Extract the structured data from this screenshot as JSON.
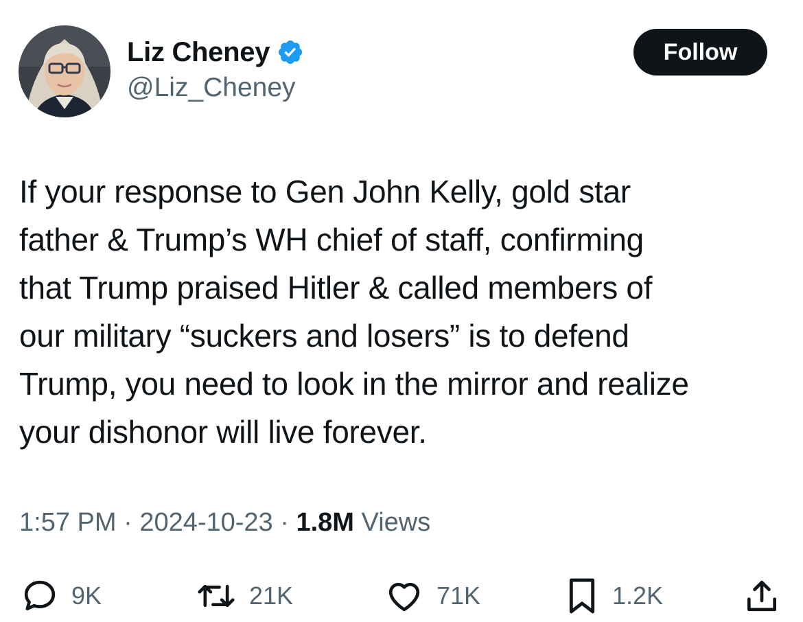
{
  "author": {
    "display_name": "Liz Cheney",
    "handle": "@Liz_Cheney",
    "verified": true,
    "avatar_icon": "profile-photo"
  },
  "follow_label": "Follow",
  "tweet": {
    "text_lines": [
      "If your response to Gen John Kelly, gold star",
      "father & Trump’s WH chief of staff, confirming",
      "that Trump praised Hitler & called members of",
      "our military “suckers and losers” is to defend",
      "Trump, you need to look in the mirror and realize",
      "your dishonor will live forever."
    ]
  },
  "meta": {
    "time": "1:57 PM",
    "separator": "·",
    "date": "2024-10-23",
    "views_count": "1.8M",
    "views_label": "Views"
  },
  "actions": {
    "reply": {
      "icon": "reply-icon",
      "count": "9K"
    },
    "repost": {
      "icon": "repost-icon",
      "count": "21K"
    },
    "like": {
      "icon": "heart-icon",
      "count": "71K"
    },
    "bookmark": {
      "icon": "bookmark-icon",
      "count": "1.2K"
    },
    "share": {
      "icon": "share-icon"
    }
  },
  "colors": {
    "text_primary": "#0f1419",
    "text_secondary": "#536471",
    "verified_blue": "#1d9bf0",
    "follow_bg": "#0f1419"
  }
}
